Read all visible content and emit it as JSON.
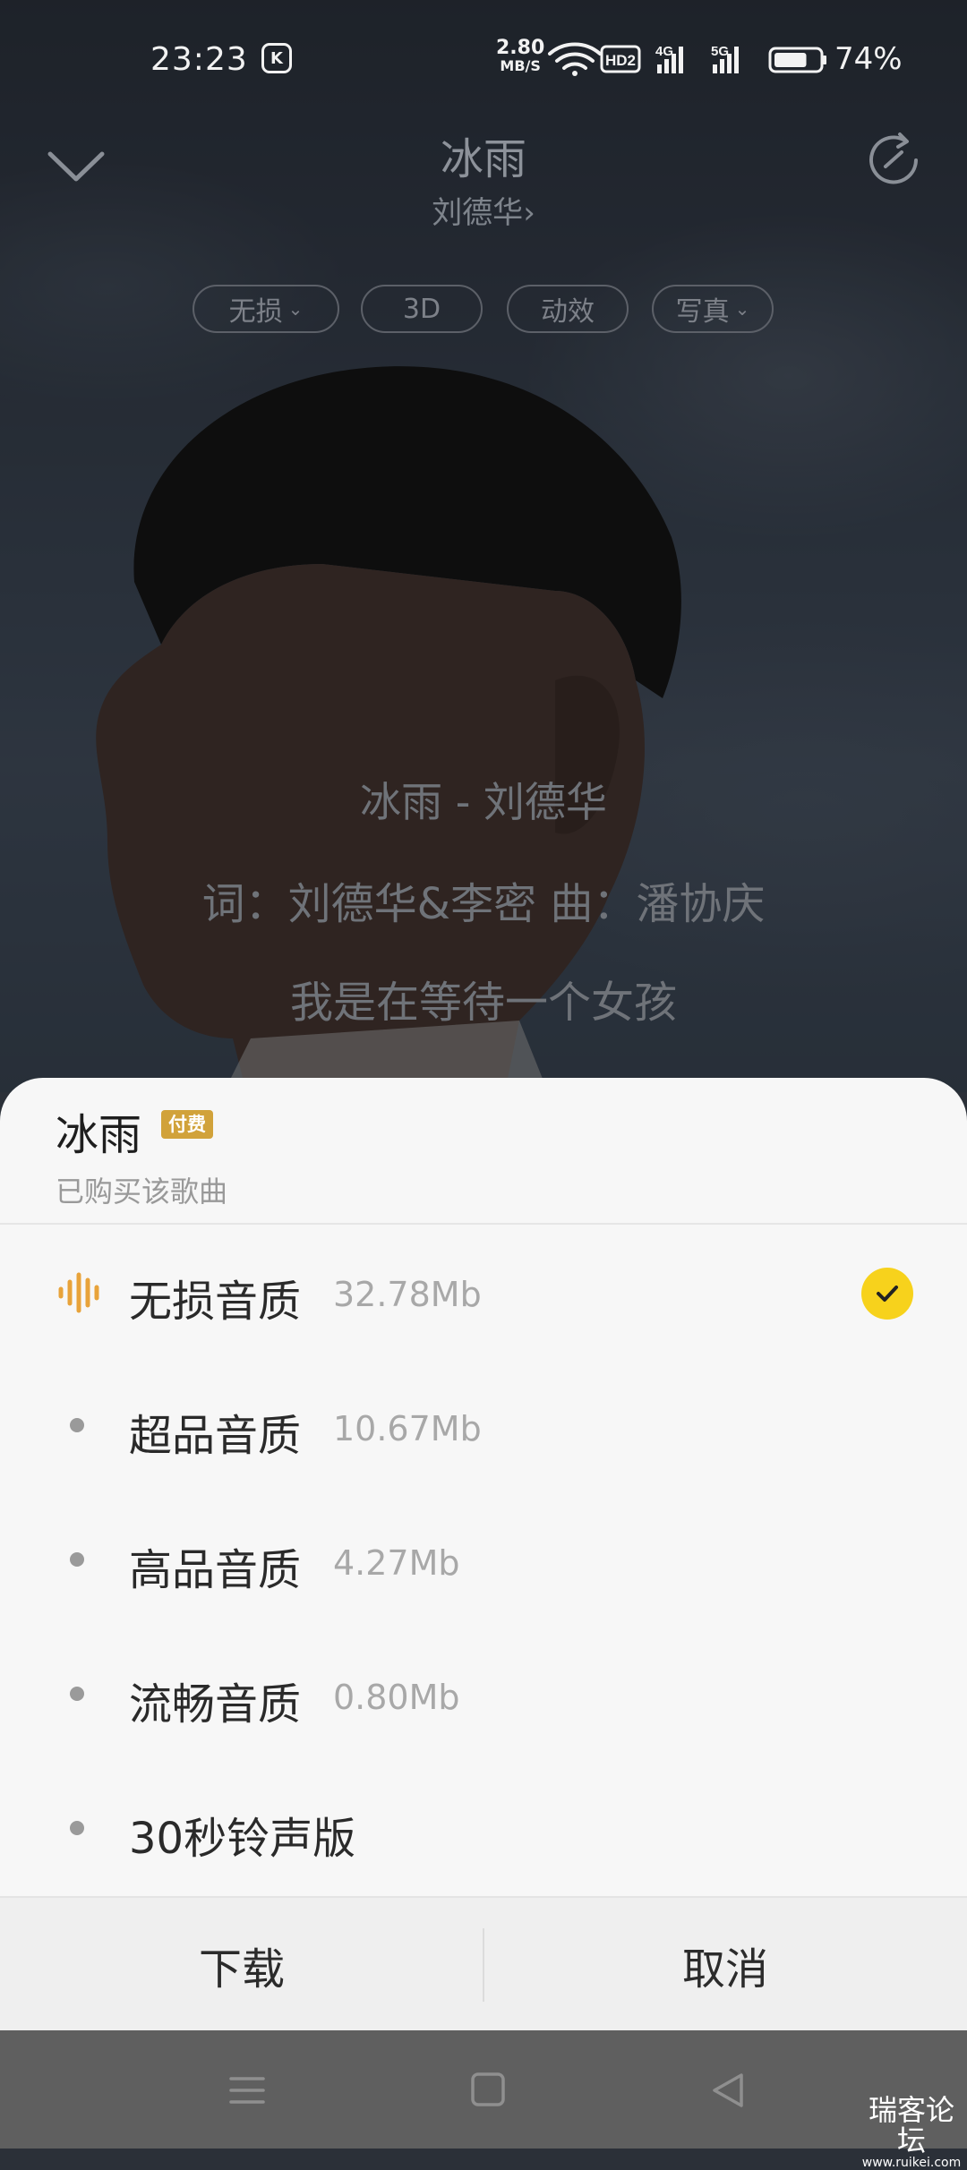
{
  "status_bar": {
    "time": "23:23",
    "network_speed_value": "2.80",
    "network_speed_unit": "MB/S",
    "hd_label": "HD2",
    "net_4g": "4G",
    "net_5g": "5G",
    "battery_percent": "74%",
    "battery_level": 0.74
  },
  "player": {
    "song_title": "冰雨",
    "artist": "刘德华",
    "artist_chevron": "›",
    "chips": [
      {
        "label": "无损",
        "has_caret": true
      },
      {
        "label": "3D",
        "has_caret": false
      },
      {
        "label": "动效",
        "has_caret": false
      },
      {
        "label": "写真",
        "has_caret": true
      }
    ],
    "lyrics": [
      "冰雨 - 刘德华",
      "词：刘德华&李密 曲：潘协庆",
      "我是在等待一个女孩"
    ]
  },
  "sheet": {
    "title": "冰雨",
    "badge": "付费",
    "subtitle": "已购买该歌曲",
    "qualities": [
      {
        "label": "无损音质",
        "size": "32.78Mb",
        "selected": true,
        "icon": "waveform-icon"
      },
      {
        "label": "超品音质",
        "size": "10.67Mb",
        "selected": false
      },
      {
        "label": "高品音质",
        "size": "4.27Mb",
        "selected": false
      },
      {
        "label": "流畅音质",
        "size": "0.80Mb",
        "selected": false
      },
      {
        "label": "30秒铃声版",
        "size": "",
        "selected": false
      }
    ],
    "download_label": "下载",
    "cancel_label": "取消"
  },
  "watermark": {
    "main": "瑞客论坛",
    "sub": "www.ruikei.com"
  },
  "colors": {
    "accent_yellow": "#f7d21c",
    "badge_gold": "#d1a23a",
    "wave_orange": "#e8a33a"
  }
}
